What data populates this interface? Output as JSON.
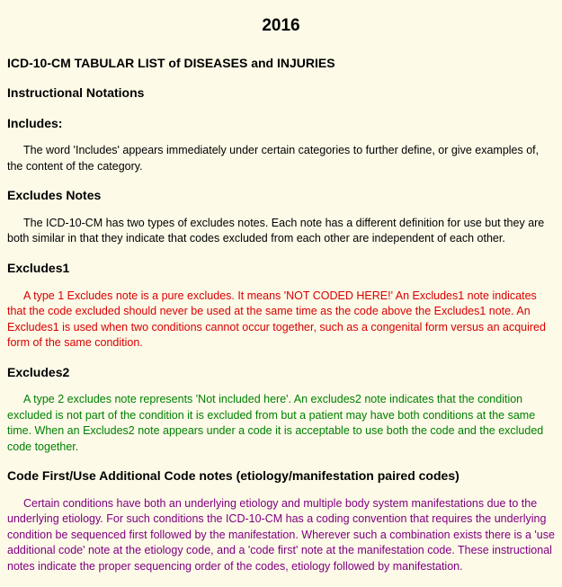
{
  "year": "2016",
  "title": "ICD-10-CM TABULAR LIST of DISEASES and INJURIES",
  "sections": {
    "instructional_notations": "Instructional Notations",
    "includes": {
      "heading": "Includes:",
      "body": "The word 'Includes' appears immediately under certain categories to further define, or give examples of, the content of the category."
    },
    "excludes_notes": {
      "heading": "Excludes Notes",
      "body": "The ICD-10-CM has two types of excludes notes. Each note has a different definition for use but they are both similar in that they indicate that codes excluded from each other are independent of each other."
    },
    "excludes1": {
      "heading": "Excludes1",
      "body": "A type 1 Excludes note is a pure excludes. It means 'NOT CODED HERE!' An Excludes1 note indicates that the code excluded should never be used at the same time as the code above the Excludes1 note. An Excludes1 is used when two conditions cannot occur together, such as a congenital form versus an acquired form of the same condition."
    },
    "excludes2": {
      "heading": "Excludes2",
      "body": "A type 2 excludes note represents 'Not included here'. An excludes2 note indicates that the condition excluded is not part of the condition it is excluded from but a patient may have both conditions at the same time. When an Excludes2 note appears under a code it is acceptable to use both the code and the excluded code together."
    },
    "code_first": {
      "heading": "Code First/Use Additional Code notes (etiology/manifestation paired codes)",
      "body": "Certain conditions have both an underlying etiology and multiple body system manifestations due to the underlying etiology. For such conditions the ICD-10-CM has a coding convention that requires the underlying condition be sequenced first followed by the manifestation. Wherever such a combination exists there is a 'use additional code' note at the etiology code, and a 'code first' note at the manifestation code. These instructional notes indicate the proper sequencing order of the codes, etiology followed by manifestation."
    }
  }
}
